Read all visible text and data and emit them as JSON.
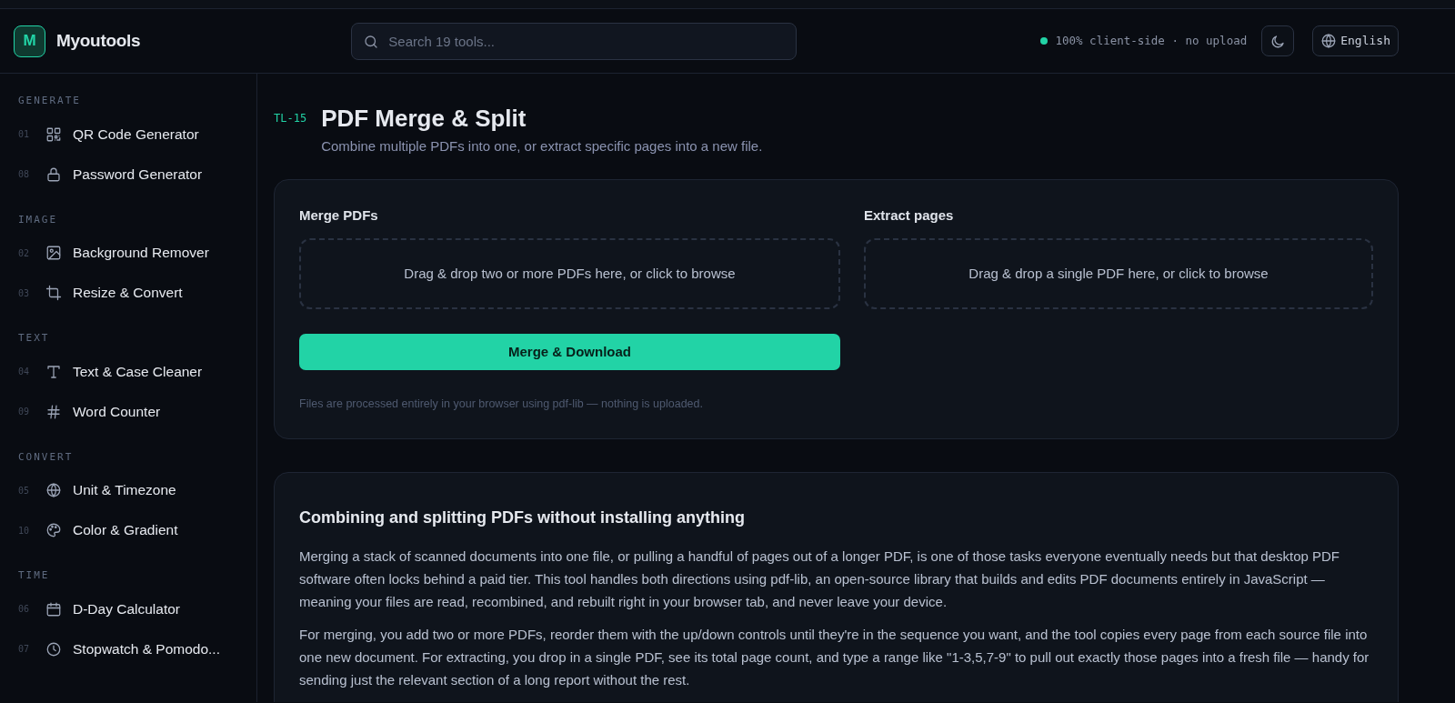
{
  "brand": {
    "logo_letter": "M",
    "name": "Myoutools"
  },
  "search": {
    "placeholder": "Search 19 tools..."
  },
  "status": {
    "text": "100% client-side · no upload",
    "color": "#22d3a6"
  },
  "language": {
    "label": "English"
  },
  "sidebar": {
    "groups": [
      {
        "title": "GENERATE",
        "items": [
          {
            "number": "01",
            "kind": "qr",
            "label": "QR Code Generator",
            "selected": false
          },
          {
            "number": "08",
            "kind": "lock",
            "label": "Password Generator",
            "selected": false
          }
        ]
      },
      {
        "title": "IMAGE",
        "items": [
          {
            "number": "02",
            "kind": "image",
            "label": "Background Remover",
            "selected": false
          },
          {
            "number": "03",
            "kind": "crop",
            "label": "Resize & Convert",
            "selected": false
          }
        ]
      },
      {
        "title": "TEXT",
        "items": [
          {
            "number": "04",
            "kind": "text",
            "label": "Text & Case Cleaner",
            "selected": false
          },
          {
            "number": "09",
            "kind": "hash",
            "label": "Word Counter",
            "selected": false
          }
        ]
      },
      {
        "title": "CONVERT",
        "items": [
          {
            "number": "05",
            "kind": "globe",
            "label": "Unit & Timezone",
            "selected": false
          },
          {
            "number": "10",
            "kind": "palette",
            "label": "Color & Gradient",
            "selected": false
          }
        ]
      },
      {
        "title": "TIME",
        "items": [
          {
            "number": "06",
            "kind": "calendar",
            "label": "D-Day Calculator",
            "selected": false
          },
          {
            "number": "07",
            "kind": "clock",
            "label": "Stopwatch & Pomodo...",
            "selected": false
          }
        ]
      }
    ]
  },
  "page": {
    "code": "TL-15",
    "title": "PDF Merge & Split",
    "subtitle": "Combine multiple PDFs into one, or extract specific pages into a new file."
  },
  "tool": {
    "merge": {
      "label": "Merge PDFs",
      "dropzone": "Drag & drop two or more PDFs here, or click to browse",
      "button": "Merge & Download"
    },
    "extract": {
      "label": "Extract pages",
      "dropzone": "Drag & drop a single PDF here, or click to browse"
    },
    "note": "Files are processed entirely in your browser using pdf-lib — nothing is uploaded."
  },
  "article": {
    "heading": "Combining and splitting PDFs without installing anything",
    "paragraphs": [
      "Merging a stack of scanned documents into one file, or pulling a handful of pages out of a longer PDF, is one of those tasks everyone eventually needs but that desktop PDF software often locks behind a paid tier. This tool handles both directions using pdf-lib, an open-source library that builds and edits PDF documents entirely in JavaScript — meaning your files are read, recombined, and rebuilt right in your browser tab, and never leave your device.",
      "For merging, you add two or more PDFs, reorder them with the up/down controls until they're in the sequence you want, and the tool copies every page from each source file into one new document. For extracting, you drop in a single PDF, see its total page count, and type a range like \"1-3,5,7-9\" to pull out exactly those pages into a fresh file — handy for sending just the relevant section of a long report without the rest."
    ]
  }
}
